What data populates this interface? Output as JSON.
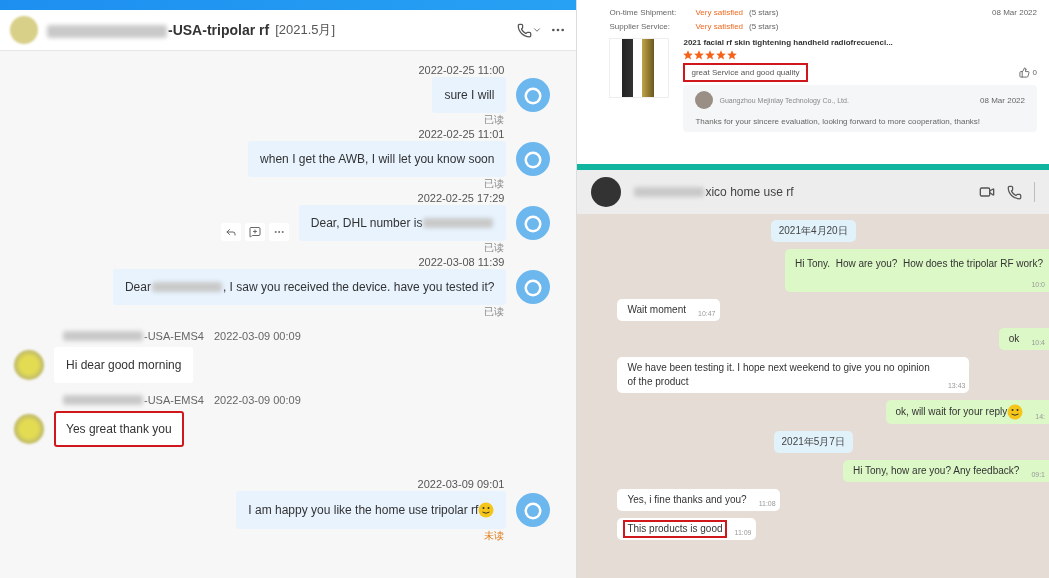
{
  "left_chat": {
    "title_parts": [
      {
        "kind": "redacted"
      },
      {
        "kind": "text",
        "text": "-USA-tripolar rf"
      }
    ],
    "title_tag": "[2021.5月]",
    "messages": [
      {
        "kind": "out",
        "time": "2022-02-25 11:00",
        "parts": [
          {
            "kind": "text",
            "text": "sure I will"
          }
        ],
        "status": "已读",
        "read": true,
        "actions": false,
        "highlighted": false
      },
      {
        "kind": "out",
        "time": "2022-02-25 11:01",
        "parts": [
          {
            "kind": "text",
            "text": "when I get the AWB, I will let you know soon"
          }
        ],
        "status": "已读",
        "read": true,
        "actions": false,
        "highlighted": false
      },
      {
        "kind": "out",
        "time": "2022-02-25 17:29",
        "parts": [
          {
            "kind": "text",
            "text": "Dear, DHL number is"
          },
          {
            "kind": "redacted"
          }
        ],
        "status": "已读",
        "read": true,
        "actions": true,
        "highlighted": false
      },
      {
        "kind": "out",
        "time": "2022-03-08 11:39",
        "parts": [
          {
            "kind": "text",
            "text": "Dear"
          },
          {
            "kind": "redacted"
          },
          {
            "kind": "text",
            "text": ", I saw you received the device. have you tested it?"
          }
        ],
        "status": "已读",
        "read": true,
        "actions": false,
        "highlighted": false
      },
      {
        "kind": "in",
        "sender_parts": [
          {
            "kind": "redacted"
          },
          {
            "kind": "text",
            "text": "-USA-EMS4"
          }
        ],
        "time": "2022-03-09 00:09",
        "parts": [
          {
            "kind": "text",
            "text": "Hi dear good morning"
          }
        ],
        "highlighted": false
      },
      {
        "kind": "in",
        "sender_parts": [
          {
            "kind": "redacted"
          },
          {
            "kind": "text",
            "text": "-USA-EMS4"
          }
        ],
        "time": "2022-03-09 00:09",
        "parts": [
          {
            "kind": "text",
            "text": "Yes great thank you"
          }
        ],
        "highlighted": true
      },
      {
        "kind": "out",
        "time": "2022-03-09 09:01",
        "parts": [
          {
            "kind": "text",
            "text": "I am happy you like the home use tripolar rf"
          },
          {
            "kind": "emoji"
          }
        ],
        "status": "未读",
        "read": false,
        "actions": false,
        "highlighted": false
      }
    ]
  },
  "review": {
    "ratings": [
      {
        "label": "On-time Shipment:",
        "value": "Very satisfied",
        "stars_text": "(5 stars)",
        "date": "08 Mar 2022"
      },
      {
        "label": "Supplier Service:",
        "value": "Very satisfied",
        "stars_text": "(5 stars)"
      }
    ],
    "product_title": "2021 facial rf skin tightening handheld radiofrecuenci...",
    "stars": 5,
    "comment": "great Service and good quality",
    "comment_highlighted": true,
    "likes": "0",
    "reply": {
      "company": "Guangzhou Mejinlay Technology Co., Ltd.",
      "date": "08 Mar 2022",
      "text": "Thanks for your sincere evaluation, looking forward to more cooperation, thanks!"
    }
  },
  "whatsapp": {
    "contact_parts": [
      {
        "kind": "redacted"
      },
      {
        "kind": "text",
        "text": "xico home use rf"
      }
    ],
    "messages": [
      {
        "kind": "date",
        "text": "2021年4月20日"
      },
      {
        "kind": "out",
        "text": "Hi Tony.  How are you?  How does the tripolar RF work?",
        "time": "10:0",
        "emoji": false,
        "tall": true,
        "highlighted": false
      },
      {
        "kind": "in",
        "text": "Wait moment",
        "time": "10:47",
        "emoji": false,
        "tall": false,
        "highlighted": false
      },
      {
        "kind": "out",
        "text": "ok",
        "time": "10:4",
        "emoji": false,
        "tall": false,
        "highlighted": false
      },
      {
        "kind": "in",
        "text": "We have been testing it. I hope next weekend to give you no opinion of the product",
        "time": "13:43",
        "emoji": false,
        "tall": false,
        "highlighted": false
      },
      {
        "kind": "out",
        "text": "ok, will wait for your reply",
        "time": "14:",
        "emoji": true,
        "tall": false,
        "highlighted": false
      },
      {
        "kind": "date",
        "text": "2021年5月7日"
      },
      {
        "kind": "out",
        "text": "Hi Tony, how are you? Any feedback?",
        "time": "09:1",
        "emoji": false,
        "tall": false,
        "highlighted": false
      },
      {
        "kind": "in",
        "text": "Yes, i fine thanks and you?",
        "time": "11:08",
        "emoji": false,
        "tall": false,
        "highlighted": false
      },
      {
        "kind": "in",
        "text": "This products is good",
        "time": "11:09",
        "emoji": false,
        "tall": false,
        "highlighted": true
      }
    ]
  }
}
